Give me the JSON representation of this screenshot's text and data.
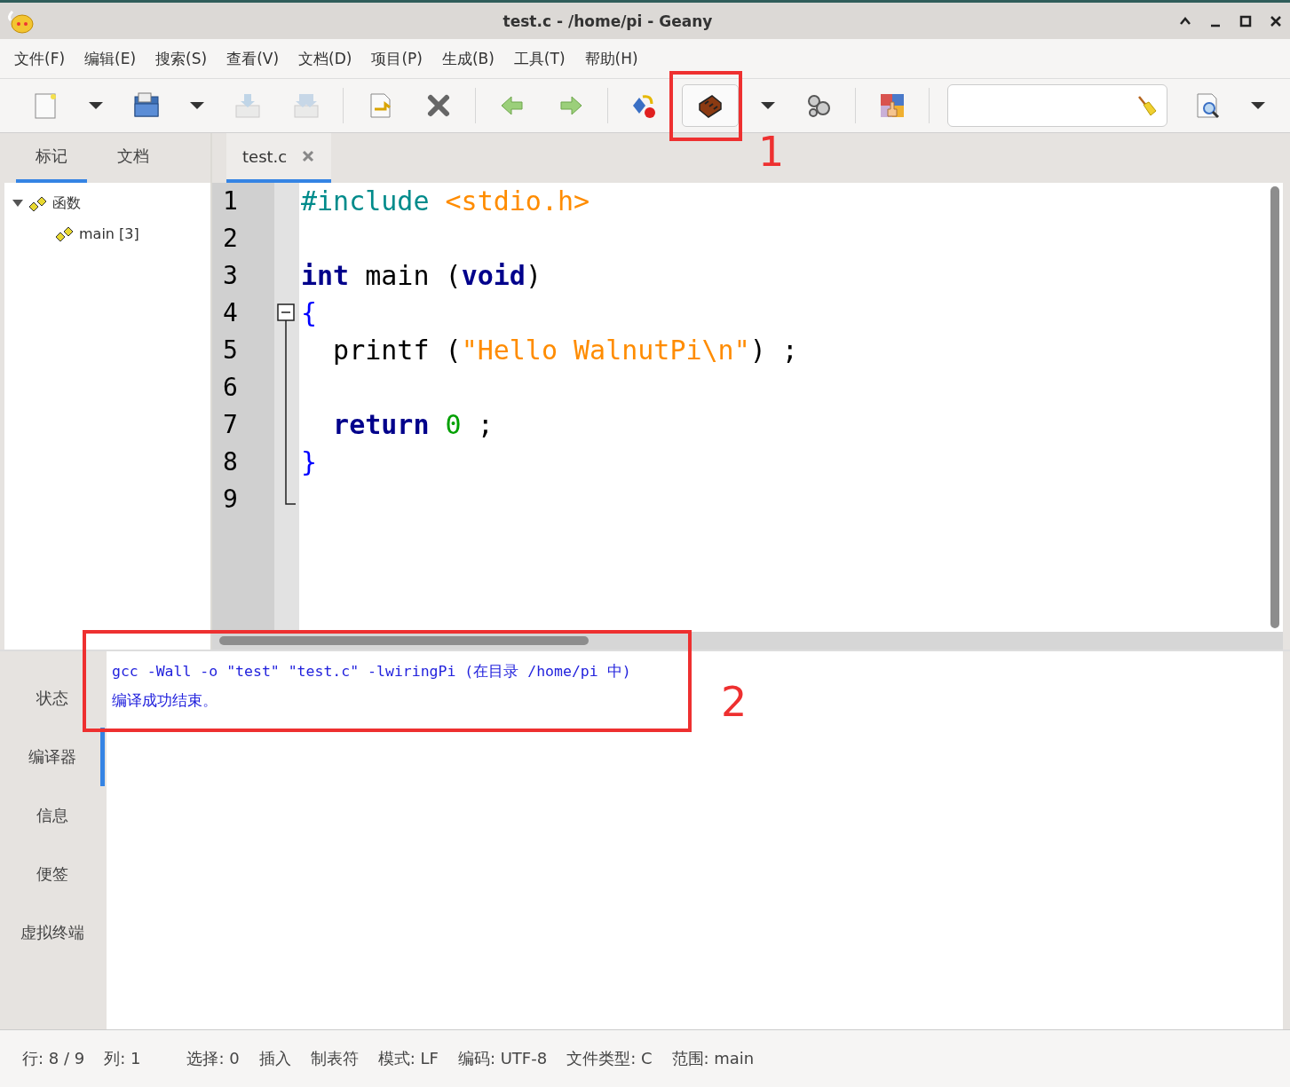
{
  "window": {
    "title": "test.c - /home/pi - Geany"
  },
  "menu": [
    "文件(F)",
    "编辑(E)",
    "搜索(S)",
    "查看(V)",
    "文档(D)",
    "项目(P)",
    "生成(B)",
    "工具(T)",
    "帮助(H)"
  ],
  "toolbar": [
    {
      "kind": "button",
      "disabled": false,
      "pressed": false
    },
    {
      "kind": "dropdown"
    },
    {
      "kind": "button",
      "disabled": false,
      "pressed": false
    },
    {
      "kind": "dropdown"
    },
    {
      "kind": "button",
      "disabled": true,
      "pressed": false
    },
    {
      "kind": "button",
      "disabled": true,
      "pressed": false
    },
    {
      "kind": "separator"
    },
    {
      "kind": "button",
      "disabled": false,
      "pressed": false
    },
    {
      "kind": "button",
      "disabled": false,
      "pressed": false
    },
    {
      "kind": "separator"
    },
    {
      "kind": "button",
      "disabled": false,
      "pressed": false
    },
    {
      "kind": "button",
      "disabled": false,
      "pressed": false
    },
    {
      "kind": "separator"
    },
    {
      "kind": "button",
      "disabled": false,
      "pressed": false
    },
    {
      "kind": "button",
      "disabled": false,
      "pressed": true
    },
    {
      "kind": "dropdown"
    },
    {
      "kind": "button",
      "disabled": false,
      "pressed": false
    },
    {
      "kind": "separator"
    },
    {
      "kind": "button",
      "disabled": false,
      "pressed": false
    },
    {
      "kind": "separator"
    },
    {
      "kind": "search"
    },
    {
      "kind": "button",
      "disabled": false,
      "pressed": false
    },
    {
      "kind": "dropdown"
    }
  ],
  "sidebar": {
    "tabs": [
      {
        "label": "标记",
        "selected": true
      },
      {
        "label": "文档",
        "selected": false
      }
    ],
    "tree": [
      {
        "label": "函数",
        "expanded": true,
        "children": [
          {
            "label": "main [3]"
          }
        ]
      }
    ]
  },
  "editor": {
    "tabs": [
      {
        "label": "test.c",
        "selected": true
      }
    ],
    "lines": [
      {
        "number": "1",
        "tokens": [
          {
            "kind": "preproc",
            "text": "#include "
          },
          {
            "kind": "string",
            "text": "<stdio.h>"
          }
        ]
      },
      {
        "number": "2"
      },
      {
        "number": "3",
        "tokens": [
          {
            "kind": "keyword",
            "text": "int"
          },
          {
            "kind": "plain",
            "text": " main ("
          },
          {
            "kind": "keyword",
            "text": "void"
          },
          {
            "kind": "plain",
            "text": ")"
          }
        ]
      },
      {
        "number": "4",
        "fold_start": true,
        "tokens": [
          {
            "kind": "brace",
            "text": "{"
          }
        ]
      },
      {
        "number": "5",
        "tokens": [
          {
            "kind": "plain",
            "text": "  printf ("
          },
          {
            "kind": "string",
            "text": "\"Hello WalnutPi\\n\""
          },
          {
            "kind": "plain",
            "text": ") ;"
          }
        ]
      },
      {
        "number": "6"
      },
      {
        "number": "7",
        "tokens": [
          {
            "kind": "keyword",
            "text": "  return "
          },
          {
            "kind": "number",
            "text": "0"
          },
          {
            "kind": "plain",
            "text": " ;"
          }
        ]
      },
      {
        "number": "8",
        "tokens": [
          {
            "kind": "brace",
            "text": "}"
          }
        ]
      },
      {
        "number": "9",
        "fold_end": true
      }
    ]
  },
  "messages": {
    "tabs": [
      {
        "label": "状态",
        "selected": false
      },
      {
        "label": "编译器",
        "selected": true
      },
      {
        "label": "信息",
        "selected": false
      },
      {
        "label": "便签",
        "selected": false
      },
      {
        "label": "虚拟终端",
        "selected": false
      }
    ],
    "lines": [
      "gcc -Wall -o \"test\" \"test.c\" -lwiringPi (在目录 /home/pi 中)",
      "编译成功结束。"
    ]
  },
  "status_bar": [
    "行: 8 / 9",
    "列: 1",
    "选择: 0",
    "插入",
    "制表符",
    "模式: LF",
    "编码: UTF-8",
    "文件类型: C",
    "范围: main"
  ],
  "annotations": [
    {
      "label": "1"
    },
    {
      "label": "2"
    }
  ]
}
